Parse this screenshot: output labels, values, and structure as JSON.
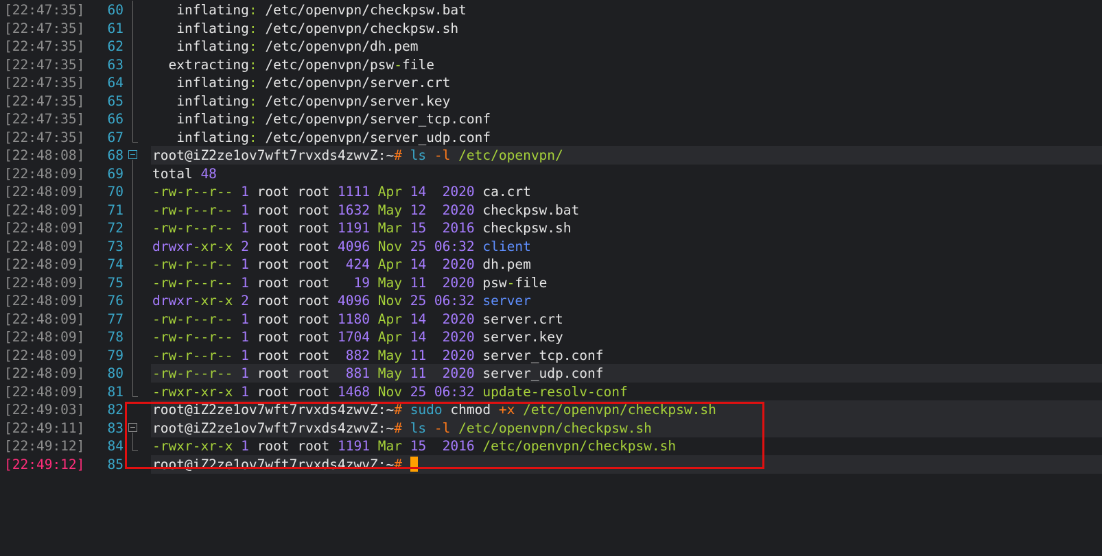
{
  "terminal": {
    "prompt": "root@iZ2ze1ov7wft7rvxds4zwvZ:~",
    "prompt_symbol": "#",
    "lines": [
      {
        "ts": "[22:47:35]",
        "n": "60",
        "segs": [
          [
            "c-label",
            "   inflating"
          ],
          [
            "c-colon",
            ":"
          ],
          [
            "c-white",
            " /etc/openvpn/checkpsw.bat"
          ]
        ]
      },
      {
        "ts": "[22:47:35]",
        "n": "61",
        "segs": [
          [
            "c-label",
            "   inflating"
          ],
          [
            "c-colon",
            ":"
          ],
          [
            "c-white",
            " /etc/openvpn/checkpsw.sh"
          ]
        ]
      },
      {
        "ts": "[22:47:35]",
        "n": "62",
        "segs": [
          [
            "c-label",
            "   inflating"
          ],
          [
            "c-colon",
            ":"
          ],
          [
            "c-white",
            " /etc/openvpn/dh.pem"
          ]
        ]
      },
      {
        "ts": "[22:47:35]",
        "n": "63",
        "segs": [
          [
            "c-label",
            "  extracting"
          ],
          [
            "c-colon",
            ":"
          ],
          [
            "c-white",
            " /etc/openvpn/psw"
          ],
          [
            "c-colon",
            "-"
          ],
          [
            "c-white",
            "file"
          ]
        ]
      },
      {
        "ts": "[22:47:35]",
        "n": "64",
        "segs": [
          [
            "c-label",
            "   inflating"
          ],
          [
            "c-colon",
            ":"
          ],
          [
            "c-white",
            " /etc/openvpn/server.crt"
          ]
        ]
      },
      {
        "ts": "[22:47:35]",
        "n": "65",
        "segs": [
          [
            "c-label",
            "   inflating"
          ],
          [
            "c-colon",
            ":"
          ],
          [
            "c-white",
            " /etc/openvpn/server.key"
          ]
        ]
      },
      {
        "ts": "[22:47:35]",
        "n": "66",
        "segs": [
          [
            "c-label",
            "   inflating"
          ],
          [
            "c-colon",
            ":"
          ],
          [
            "c-white",
            " /etc/openvpn/server_tcp.conf"
          ]
        ]
      },
      {
        "ts": "[22:47:35]",
        "n": "67",
        "segs": [
          [
            "c-label",
            "   inflating"
          ],
          [
            "c-colon",
            ":"
          ],
          [
            "c-white",
            " /etc/openvpn/server_udp.conf"
          ]
        ]
      },
      {
        "ts": "[22:48:08]",
        "n": "68",
        "segs": [
          [
            "c-prompt",
            "root@iZ2ze1ov7wft7rvxds4zwvZ:~"
          ],
          [
            "c-hash",
            "#"
          ],
          [
            "c-cmd",
            " ls"
          ],
          [
            "c-flag",
            " -l"
          ],
          [
            "c-path",
            " /etc/openvpn/"
          ]
        ]
      },
      {
        "ts": "[22:48:09]",
        "n": "69",
        "segs": [
          [
            "c-white",
            "total"
          ],
          [
            "c-num",
            " 48"
          ]
        ]
      },
      {
        "ts": "[22:48:09]",
        "n": "70",
        "segs": [
          [
            "c-perm-r",
            "-rw-r--r--"
          ],
          [
            "c-num",
            " 1"
          ],
          [
            "c-white",
            " root root"
          ],
          [
            "c-num",
            " 1111"
          ],
          [
            "c-month",
            " Apr"
          ],
          [
            "c-date",
            " 14  2020"
          ],
          [
            "c-white",
            " ca.crt"
          ]
        ]
      },
      {
        "ts": "[22:48:09]",
        "n": "71",
        "segs": [
          [
            "c-perm-r",
            "-rw-r--r--"
          ],
          [
            "c-num",
            " 1"
          ],
          [
            "c-white",
            " root root"
          ],
          [
            "c-num",
            " 1632"
          ],
          [
            "c-month",
            " May"
          ],
          [
            "c-date",
            " 12  2020"
          ],
          [
            "c-white",
            " checkpsw.bat"
          ]
        ]
      },
      {
        "ts": "[22:48:09]",
        "n": "72",
        "segs": [
          [
            "c-perm-r",
            "-rw-r--r--"
          ],
          [
            "c-num",
            " 1"
          ],
          [
            "c-white",
            " root root"
          ],
          [
            "c-num",
            " 1191"
          ],
          [
            "c-month",
            " Mar"
          ],
          [
            "c-date",
            " 15  2016"
          ],
          [
            "c-white",
            " checkpsw.sh"
          ]
        ]
      },
      {
        "ts": "[22:48:09]",
        "n": "73",
        "segs": [
          [
            "c-perm-d",
            "drwxr"
          ],
          [
            "c-perm-r",
            "-xr-x"
          ],
          [
            "c-num",
            " 2"
          ],
          [
            "c-white",
            " root root"
          ],
          [
            "c-num",
            " 4096"
          ],
          [
            "c-month",
            " Nov"
          ],
          [
            "c-date",
            " 25 06:32"
          ],
          [
            "c-dir",
            " client"
          ]
        ]
      },
      {
        "ts": "[22:48:09]",
        "n": "74",
        "segs": [
          [
            "c-perm-r",
            "-rw-r--r--"
          ],
          [
            "c-num",
            " 1"
          ],
          [
            "c-white",
            " root root"
          ],
          [
            "c-num",
            "  424"
          ],
          [
            "c-month",
            " Apr"
          ],
          [
            "c-date",
            " 14  2020"
          ],
          [
            "c-white",
            " dh.pem"
          ]
        ]
      },
      {
        "ts": "[22:48:09]",
        "n": "75",
        "segs": [
          [
            "c-perm-r",
            "-rw-r--r--"
          ],
          [
            "c-num",
            " 1"
          ],
          [
            "c-white",
            " root root"
          ],
          [
            "c-num",
            "   19"
          ],
          [
            "c-month",
            " May"
          ],
          [
            "c-date",
            " 11  2020"
          ],
          [
            "c-white",
            " psw"
          ],
          [
            "c-colon",
            "-"
          ],
          [
            "c-white",
            "file"
          ]
        ]
      },
      {
        "ts": "[22:48:09]",
        "n": "76",
        "segs": [
          [
            "c-perm-d",
            "drwxr"
          ],
          [
            "c-perm-r",
            "-xr-x"
          ],
          [
            "c-num",
            " 2"
          ],
          [
            "c-white",
            " root root"
          ],
          [
            "c-num",
            " 4096"
          ],
          [
            "c-month",
            " Nov"
          ],
          [
            "c-date",
            " 25 06:32"
          ],
          [
            "c-dir",
            " server"
          ]
        ]
      },
      {
        "ts": "[22:48:09]",
        "n": "77",
        "segs": [
          [
            "c-perm-r",
            "-rw-r--r--"
          ],
          [
            "c-num",
            " 1"
          ],
          [
            "c-white",
            " root root"
          ],
          [
            "c-num",
            " 1180"
          ],
          [
            "c-month",
            " Apr"
          ],
          [
            "c-date",
            " 14  2020"
          ],
          [
            "c-white",
            " server.crt"
          ]
        ]
      },
      {
        "ts": "[22:48:09]",
        "n": "78",
        "segs": [
          [
            "c-perm-r",
            "-rw-r--r--"
          ],
          [
            "c-num",
            " 1"
          ],
          [
            "c-white",
            " root root"
          ],
          [
            "c-num",
            " 1704"
          ],
          [
            "c-month",
            " Apr"
          ],
          [
            "c-date",
            " 14  2020"
          ],
          [
            "c-white",
            " server.key"
          ]
        ]
      },
      {
        "ts": "[22:48:09]",
        "n": "79",
        "segs": [
          [
            "c-perm-r",
            "-rw-r--r--"
          ],
          [
            "c-num",
            " 1"
          ],
          [
            "c-white",
            " root root"
          ],
          [
            "c-num",
            "  882"
          ],
          [
            "c-month",
            " May"
          ],
          [
            "c-date",
            " 11  2020"
          ],
          [
            "c-white",
            " server_tcp.conf"
          ]
        ]
      },
      {
        "ts": "[22:48:09]",
        "n": "80",
        "segs": [
          [
            "c-perm-r",
            "-rw-r--r--"
          ],
          [
            "c-num",
            " 1"
          ],
          [
            "c-white",
            " root root"
          ],
          [
            "c-num",
            "  881"
          ],
          [
            "c-month",
            " May"
          ],
          [
            "c-date",
            " 11  2020"
          ],
          [
            "c-white",
            " server_udp.conf"
          ]
        ]
      },
      {
        "ts": "[22:48:09]",
        "n": "81",
        "segs": [
          [
            "c-perm-r",
            "-rwxr-xr-x"
          ],
          [
            "c-num",
            " 1"
          ],
          [
            "c-white",
            " root root"
          ],
          [
            "c-num",
            " 1468"
          ],
          [
            "c-month",
            " Nov"
          ],
          [
            "c-date",
            " 25 06:32"
          ],
          [
            "c-path",
            " update-resolv-conf"
          ]
        ]
      },
      {
        "ts": "[22:49:03]",
        "n": "82",
        "segs": [
          [
            "c-prompt",
            "root@iZ2ze1ov7wft7rvxds4zwvZ:~"
          ],
          [
            "c-hash",
            "#"
          ],
          [
            "c-cmd",
            " sudo"
          ],
          [
            "c-white",
            " chmod"
          ],
          [
            "c-flag",
            " +x"
          ],
          [
            "c-path",
            " /etc/openvpn/checkpsw.sh"
          ]
        ]
      },
      {
        "ts": "[22:49:11]",
        "n": "83",
        "segs": [
          [
            "c-prompt",
            "root@iZ2ze1ov7wft7rvxds4zwvZ:~"
          ],
          [
            "c-hash",
            "#"
          ],
          [
            "c-cmd",
            " ls"
          ],
          [
            "c-flag",
            " -l"
          ],
          [
            "c-path",
            " /etc/openvpn/checkpsw.sh"
          ]
        ]
      },
      {
        "ts": "[22:49:12]",
        "n": "84",
        "segs": [
          [
            "c-perm-r",
            "-rwxr-xr-x"
          ],
          [
            "c-num",
            " 1"
          ],
          [
            "c-white",
            " root root"
          ],
          [
            "c-num",
            " 1191"
          ],
          [
            "c-month",
            " Mar"
          ],
          [
            "c-date",
            " 15  2016"
          ],
          [
            "c-path",
            " /etc/openvpn/checkpsw.sh"
          ]
        ]
      },
      {
        "ts": "[22:49:12]",
        "n": "85",
        "segs": [
          [
            "c-prompt",
            "root@iZ2ze1ov7wft7rvxds4zwvZ:~"
          ],
          [
            "c-hash",
            "#"
          ],
          [
            "c-white",
            " "
          ]
        ]
      }
    ]
  },
  "colors": {
    "background": "#1e1f22",
    "highlight_box": "#e01010",
    "cursor": "#ffa000",
    "active_timestamp": "#ff2d7a"
  }
}
